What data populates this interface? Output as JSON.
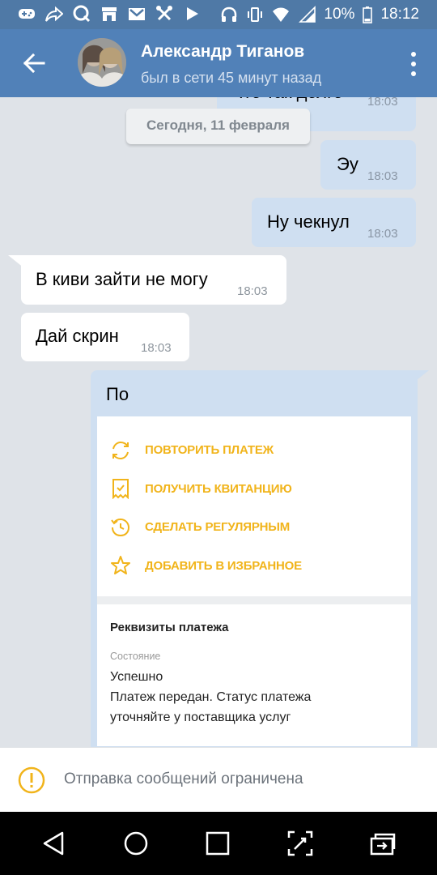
{
  "status_bar": {
    "battery": "10%",
    "time": "18:12",
    "left_icons": [
      "gamepad-icon",
      "share-icon",
      "qiwi-icon",
      "store-icon",
      "gmail-icon",
      "tools-icon",
      "play-icon"
    ],
    "right_icons": [
      "headphones-icon",
      "vibrate-icon",
      "wifi-icon",
      "signal-icon",
      "battery-icon"
    ]
  },
  "header": {
    "name": "Александр Тиганов",
    "status": "был в сети 45 минут назад"
  },
  "chat": {
    "date_divider": "Сегодня, 11 февраля",
    "partial_message": {
      "text": "Что так долго",
      "time": "18:03"
    },
    "messages": [
      {
        "text": "Эу",
        "time": "18:03",
        "direction": "out"
      },
      {
        "text": "Ну чекнул",
        "time": "18:03",
        "direction": "out"
      },
      {
        "text": "В киви зайти не могу",
        "time": "18:03",
        "direction": "in"
      },
      {
        "text": "Дай скрин",
        "time": "18:03",
        "direction": "in"
      },
      {
        "text": "По",
        "direction": "out"
      }
    ]
  },
  "attachment": {
    "actions": [
      {
        "label": "ПОВТОРИТЬ ПЛАТЕЖ",
        "icon": "repeat-icon"
      },
      {
        "label": "ПОЛУЧИТЬ КВИТАНЦИЮ",
        "icon": "receipt-icon"
      },
      {
        "label": "СДЕЛАТЬ РЕГУЛЯРНЫМ",
        "icon": "clock-repeat-icon"
      },
      {
        "label": "ДОБАВИТЬ В ИЗБРАННОЕ",
        "icon": "star-icon"
      }
    ],
    "details_title": "Реквизиты платежа",
    "state_label": "Состояние",
    "state_value": "Успешно",
    "state_note_line1": "Платеж передан. Статус платежа",
    "state_note_line2": "уточняйте у поставщика услуг"
  },
  "notice": {
    "text": "Отправка сообщений ограничена"
  },
  "colors": {
    "header_bg": "#5181b8",
    "status_bar_bg": "#4f79a6",
    "outgoing_bubble": "#cfdff1",
    "incoming_bubble": "#ffffff",
    "chat_bg": "#dfe3e8",
    "accent_orange": "#f1b41b"
  }
}
